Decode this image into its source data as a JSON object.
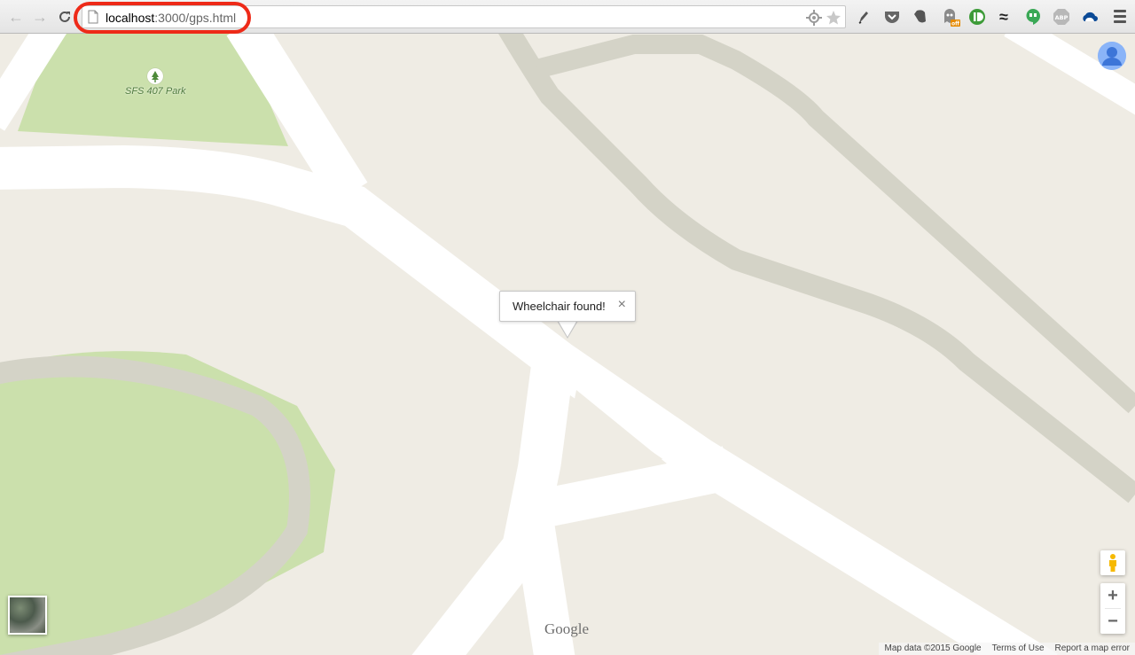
{
  "browser": {
    "url_host": "localhost",
    "url_path": ":3000/gps.html",
    "highlight_color": "#ee2a18"
  },
  "icons": {
    "back": "back-arrow-icon",
    "forward": "forward-arrow-icon",
    "reload": "reload-icon",
    "page": "page-icon",
    "location": "location-icon",
    "bookmark": "star-icon",
    "menu": "hamburger-menu-icon",
    "extensions": [
      "pen-extension-icon",
      "pocket-icon",
      "evernote-icon",
      "ghostery-icon",
      "pushbullet-icon",
      "wave-extension-icon",
      "hangouts-icon",
      "adblock-plus-icon",
      "cloud-icon"
    ]
  },
  "extensions": {
    "badge_off": "off",
    "abp": "ABP",
    "wave": "≈"
  },
  "map": {
    "park_label": "SFS 407 Park",
    "infowindow_text": "Wheelchair found!",
    "infowindow_close": "×",
    "zoom_in": "+",
    "zoom_out": "−",
    "logo": "Google",
    "footer": [
      "Map data ©2015 Google",
      "Terms of Use",
      "Report a map error"
    ],
    "colors": {
      "land": "#efece4",
      "park": "#cbe0ac",
      "road": "#ffffff",
      "path": "#d4d3c7"
    }
  }
}
